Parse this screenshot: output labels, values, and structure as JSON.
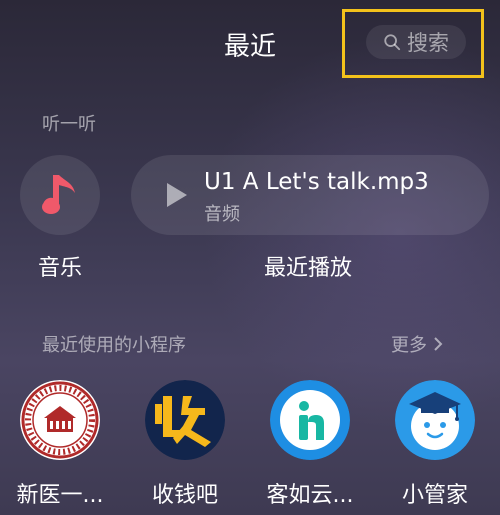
{
  "header": {
    "title": "最近",
    "search_label": "搜索"
  },
  "listen": {
    "section_title": "听一听",
    "music": {
      "label": "音乐",
      "icon": "music-note-icon"
    },
    "recent": {
      "label": "最近播放",
      "track": "U1 A Let's talk.mp3",
      "type": "音频",
      "icon": "play-icon"
    }
  },
  "mini_programs": {
    "section_title": "最近使用的小程序",
    "more_label": "更多",
    "items": [
      {
        "label": "新医一...",
        "icon": "hospital-seal-icon"
      },
      {
        "label": "收钱吧",
        "icon": "shouqianba-logo-icon"
      },
      {
        "label": "客如云...",
        "icon": "keruyun-logo-icon"
      },
      {
        "label": "小管家",
        "icon": "graduate-face-icon"
      }
    ]
  },
  "colors": {
    "highlight": "#f3c21b",
    "music_note": "#f0596a",
    "shouqianba_bg": "#12254c",
    "shouqianba_fg": "#f6b81b",
    "keruyun_bg": "#1e8ee3",
    "xiaoguanjia_bg": "#2b9ae8"
  }
}
